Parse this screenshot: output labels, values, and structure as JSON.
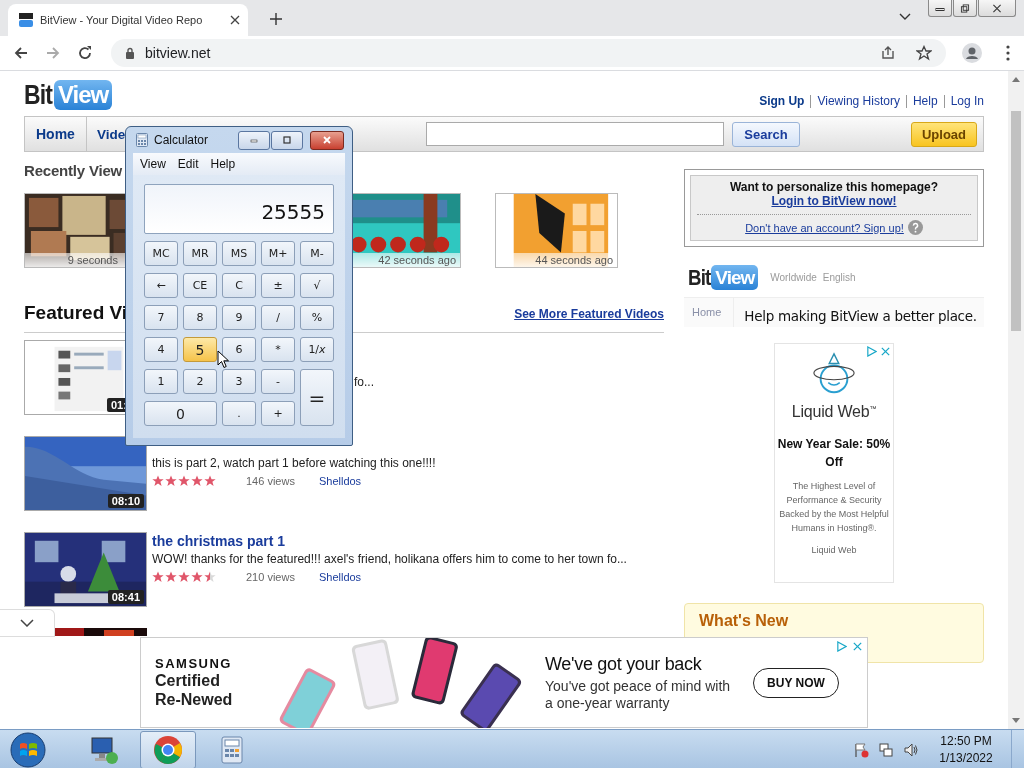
{
  "browser": {
    "tab": {
      "title": "BitView - Your Digital Video Repo"
    },
    "url": "bitview.net"
  },
  "site": {
    "logo": {
      "plain": "Bit",
      "badge": "View"
    },
    "top_links": [
      {
        "label": "Sign Up",
        "kind": "primary"
      },
      {
        "label": "Viewing History",
        "kind": "link"
      },
      {
        "label": "Help",
        "kind": "link"
      },
      {
        "label": "Log In",
        "kind": "link"
      }
    ],
    "nav_tabs": [
      {
        "label": "Home",
        "kind": "full"
      },
      {
        "label": "Vide",
        "kind": "covered"
      }
    ],
    "search_button": "Search",
    "upload_button": "Upload"
  },
  "recently_viewed": {
    "heading": "Recently View",
    "items": [
      {
        "time": "9 seconds",
        "kind": "covered"
      },
      {
        "time": "42 seconds ago",
        "kind": "full"
      },
      {
        "time": "44 seconds ago",
        "kind": "full"
      }
    ]
  },
  "featured": {
    "heading": "Featured Vi",
    "more_link": "See More Featured Videos",
    "videos": [
      {
        "kind": "covered",
        "duration": "01:",
        "description": "fo..."
      },
      {
        "kind": "untitled",
        "duration": "08:10",
        "description": "this is part 2, watch part 1 before watching this one!!!!",
        "stars": 5,
        "views": "146 views",
        "author": "Shelldos"
      },
      {
        "kind": "full",
        "duration": "08:41",
        "title": "the christmas part 1",
        "description": "WOW! thanks for the featured!!! axel's friend, holikana offers him to come to her town fo...",
        "stars": 4.5,
        "views": "210 views",
        "author": "Shelldos"
      },
      {
        "kind": "hidden"
      }
    ]
  },
  "personalize": {
    "question": "Want to personalize this homepage?",
    "login_link": "Login to BitView now!",
    "signup_link": "Don't have an account? Sign up!"
  },
  "promo_banner": {
    "logo": {
      "plain": "Bit",
      "badge": "View"
    },
    "region": "Worldwide",
    "language": "English",
    "tab": "Home",
    "caption": "Help making BitView a better place."
  },
  "side_ad": {
    "brand": "Liquid Web$^{™}$",
    "headline": "New Year Sale: 50% Off",
    "body": "The Highest Level of Performance & Security Backed by the Most Helpful Humans in Hosting®.",
    "advertiser": "Liquid Web"
  },
  "whats_new": {
    "heading": "What's New"
  },
  "bottom_ad": {
    "brand": "SAMSUNG",
    "product": [
      "Certified",
      "Re-Newed"
    ],
    "headline": "We've got your back",
    "body": "You've got peace of mind with a one-year warranty",
    "button": "BUY NOW"
  },
  "calculator": {
    "title": "Calculator",
    "menu": [
      "View",
      "Edit",
      "Help"
    ],
    "display": "25555",
    "keys": [
      {
        "label": "MC",
        "kind": "key",
        "highlighted": false
      },
      {
        "label": "MR",
        "kind": "key",
        "highlighted": false
      },
      {
        "label": "MS",
        "kind": "key",
        "highlighted": false
      },
      {
        "label": "M+",
        "kind": "key",
        "highlighted": false
      },
      {
        "label": "M-",
        "kind": "key",
        "highlighted": false
      },
      {
        "label": "←",
        "kind": "key",
        "highlighted": false
      },
      {
        "label": "CE",
        "kind": "key",
        "highlighted": false
      },
      {
        "label": "C",
        "kind": "key",
        "highlighted": false
      },
      {
        "label": "±",
        "kind": "key",
        "highlighted": false
      },
      {
        "label": "√",
        "kind": "key",
        "highlighted": false
      },
      {
        "label": "7",
        "kind": "key",
        "highlighted": false
      },
      {
        "label": "8",
        "kind": "key",
        "highlighted": false
      },
      {
        "label": "9",
        "kind": "key",
        "highlighted": false
      },
      {
        "label": "/",
        "kind": "key",
        "highlighted": false
      },
      {
        "label": "%",
        "kind": "key",
        "highlighted": false
      },
      {
        "label": "4",
        "kind": "key",
        "highlighted": false
      },
      {
        "label": "5",
        "kind": "key",
        "highlighted": true
      },
      {
        "label": "6",
        "kind": "key",
        "highlighted": false
      },
      {
        "label": "*",
        "kind": "key",
        "highlighted": false
      },
      {
        "label": "1/*x*",
        "kind": "key",
        "highlighted": false
      },
      {
        "label": "1",
        "kind": "key",
        "highlighted": false
      },
      {
        "label": "2",
        "kind": "key",
        "highlighted": false
      },
      {
        "label": "3",
        "kind": "key",
        "highlighted": false
      },
      {
        "label": "-",
        "kind": "key",
        "highlighted": false
      },
      {
        "label": "=",
        "kind": "tall",
        "highlighted": false
      },
      {
        "label": "0",
        "kind": "wide",
        "highlighted": false
      },
      {
        "label": ".",
        "kind": "key",
        "highlighted": false
      },
      {
        "label": "+",
        "kind": "key",
        "highlighted": false
      }
    ]
  },
  "taskbar": {
    "apps": [
      {
        "kind": "network",
        "active": false
      },
      {
        "kind": "chrome",
        "active": true
      },
      {
        "kind": "calculator",
        "active": false
      }
    ],
    "time": "12:50 PM",
    "date": "1/13/2022"
  }
}
